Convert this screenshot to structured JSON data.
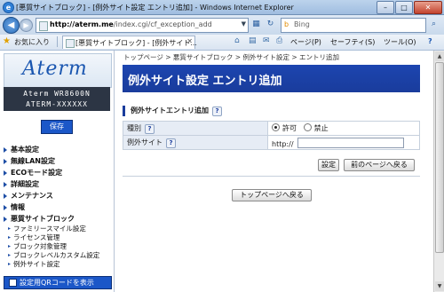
{
  "window": {
    "title": "[悪質サイトブロック] - [例外サイト設定 エントリ追加] - Windows Internet Explorer",
    "min": "–",
    "max": "□",
    "close": "✕"
  },
  "address_bar": {
    "url_host": "http://aterm.me",
    "url_path": "/index.cgi/cf_exception_add",
    "search_placeholder": "Bing"
  },
  "command_bar": {
    "favorites_label": "お気に入り",
    "tab_label": "[悪質サイトブロック] - [例外サイト...",
    "page_menu": "ページ(P)",
    "safety_menu": "セーフティ(S)",
    "tools_menu": "ツール(O)",
    "help_menu": "?"
  },
  "sidebar": {
    "logo": "Aterm",
    "model_line1": "Aterm WR8600N",
    "model_line2": "ATERM-XXXXXX",
    "save_label": "保存",
    "menu": [
      {
        "label": "基本設定"
      },
      {
        "label": "無線LAN設定"
      },
      {
        "label": "ECOモード設定"
      },
      {
        "label": "詳細設定"
      },
      {
        "label": "メンテナンス"
      },
      {
        "label": "情報"
      },
      {
        "label": "悪質サイトブロック"
      }
    ],
    "submenu": [
      {
        "label": "ファミリースマイル設定"
      },
      {
        "label": "ライセンス管理"
      },
      {
        "label": "ブロック対象管理"
      },
      {
        "label": "ブロックレベルカスタム設定"
      },
      {
        "label": "例外サイト設定"
      }
    ],
    "qr_label": "設定用QRコードを表示"
  },
  "main": {
    "breadcrumb": "トップページ > 悪質サイトブロック > 例外サイト設定 > エントリ追加",
    "page_title": "例外サイト設定 エントリ追加",
    "section_title": "例外サイトエントリ追加",
    "help_label": "?",
    "rows": {
      "type_label": "種別",
      "allow_label": "許可",
      "deny_label": "禁止",
      "site_label": "例外サイト",
      "site_prefix": "http://",
      "site_value": ""
    },
    "set_button": "設定",
    "back_button": "前のページへ戻る",
    "top_button": "トップページへ戻る"
  }
}
